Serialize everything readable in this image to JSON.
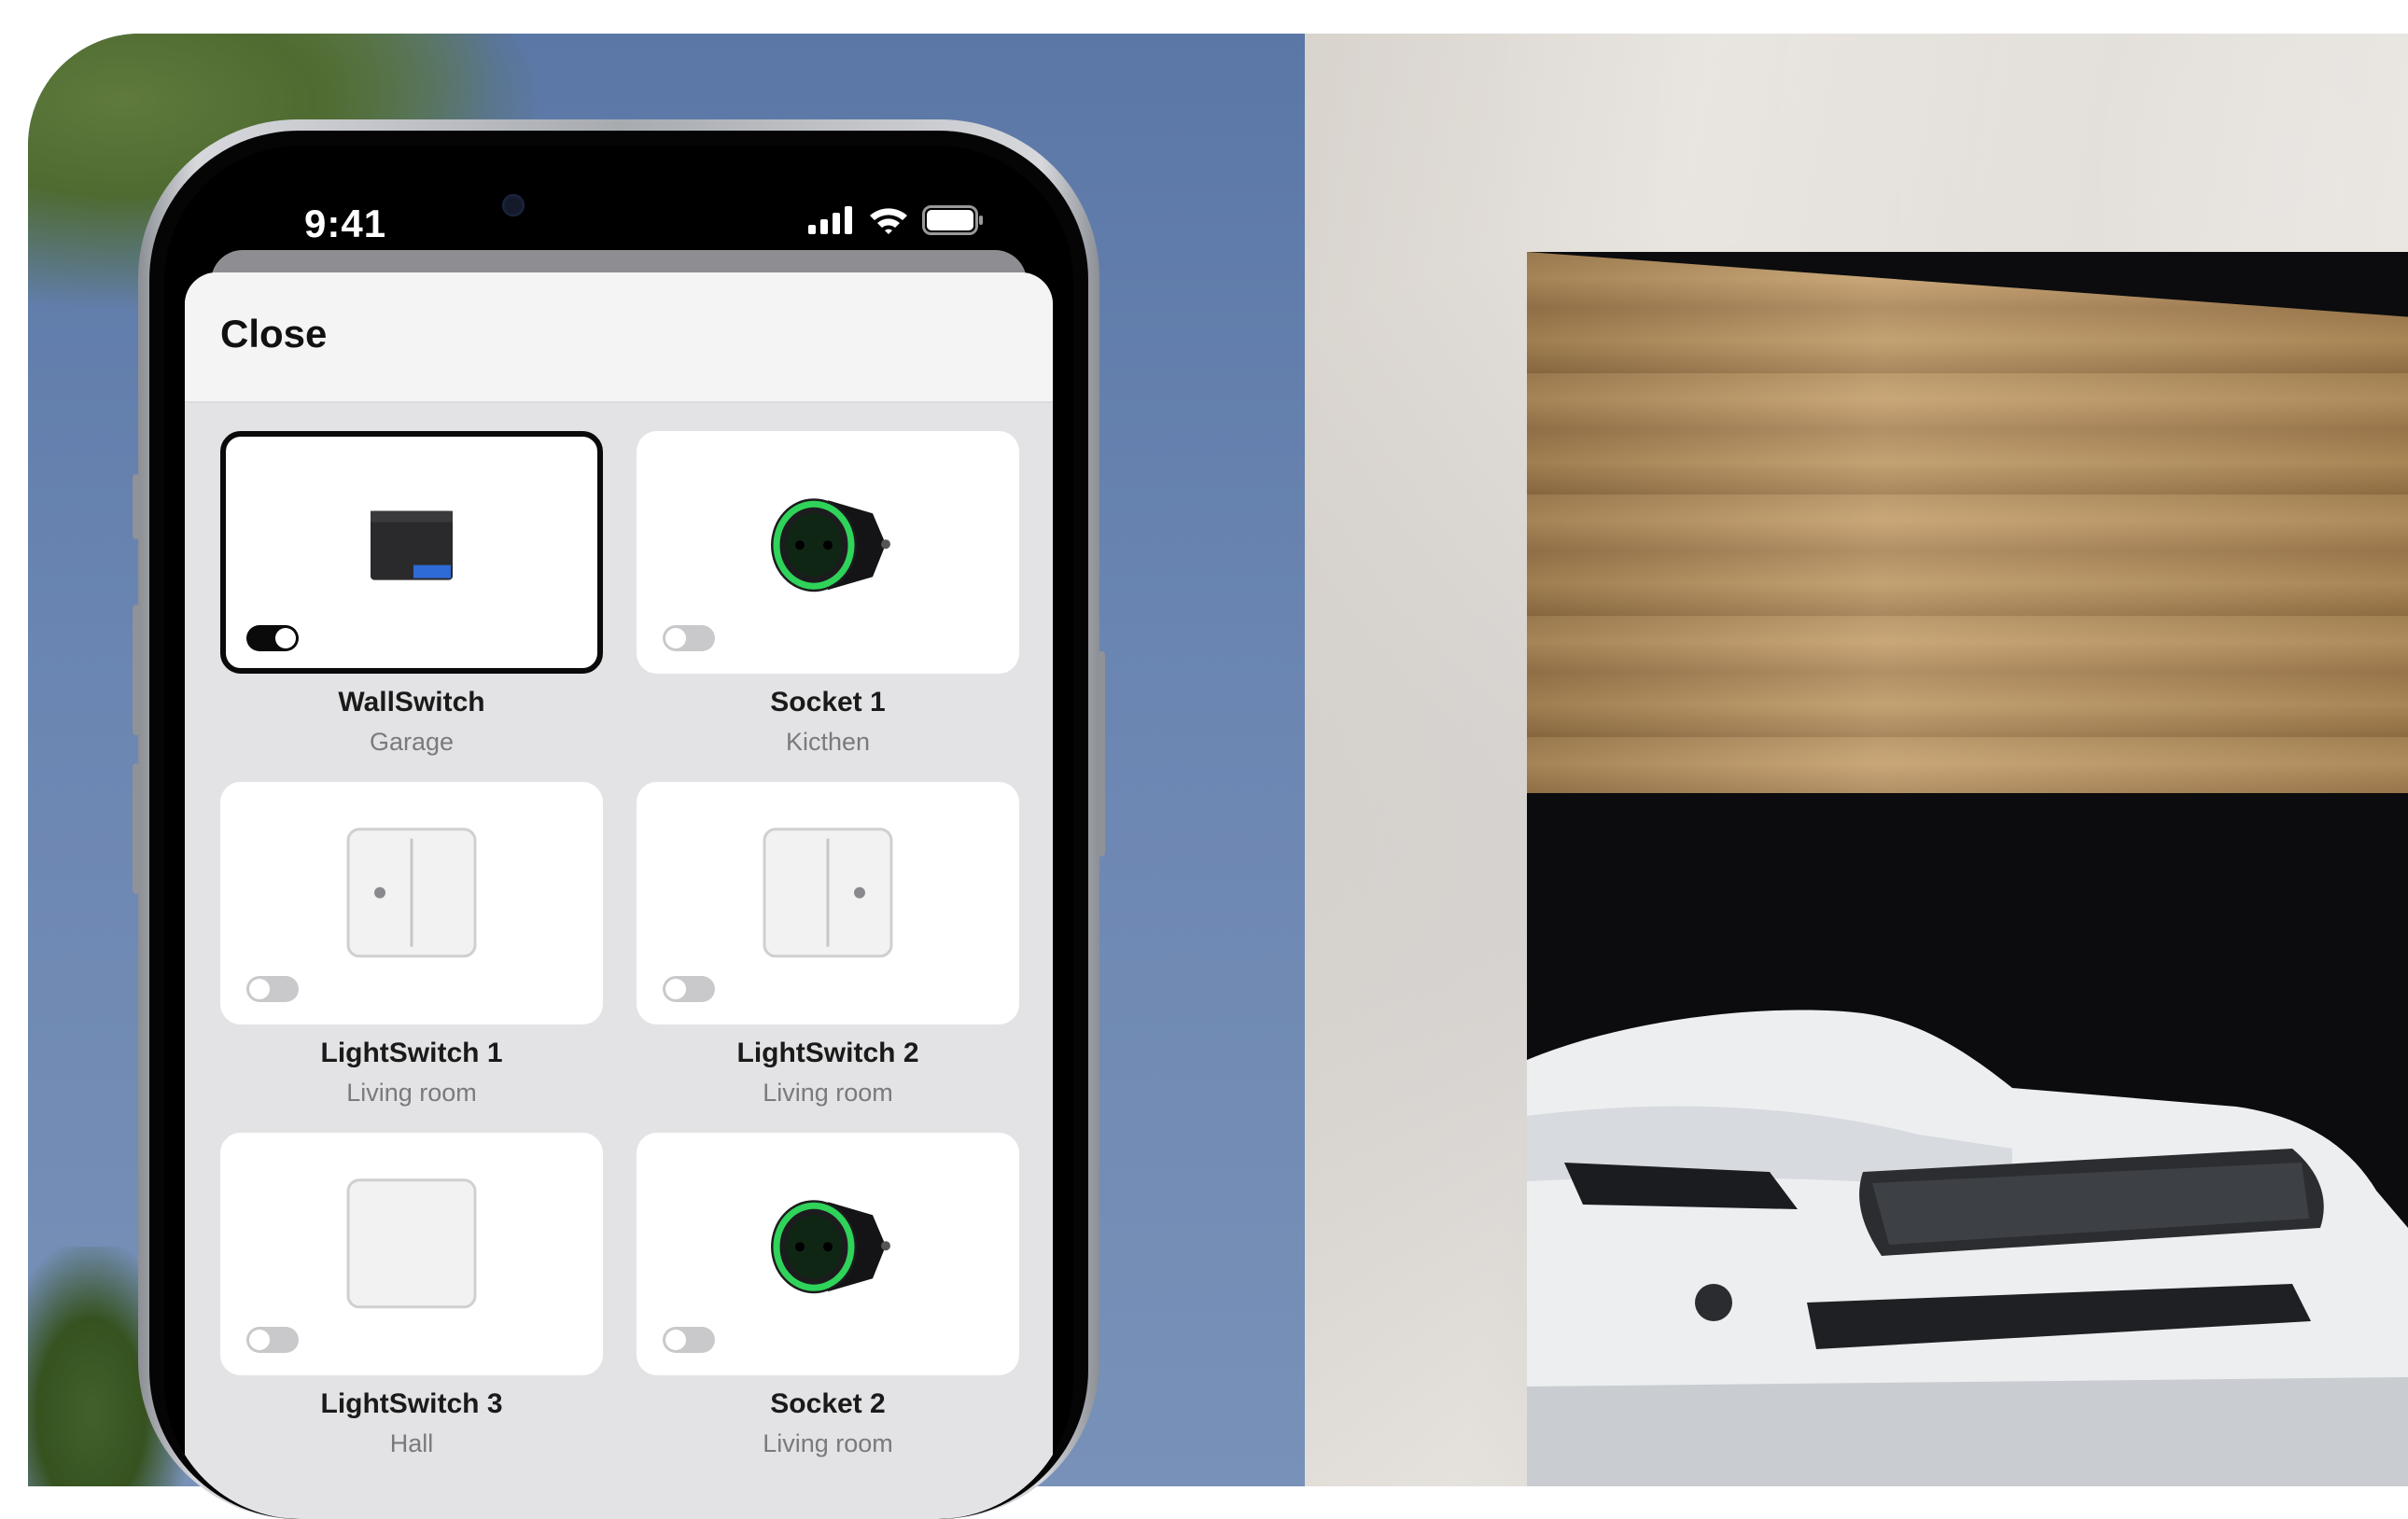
{
  "status_bar": {
    "time": "9:41"
  },
  "sheet": {
    "close_label": "Close"
  },
  "devices": [
    {
      "name": "WallSwitch",
      "room": "Garage",
      "icon": "wallswitch-icon",
      "toggle_on": true,
      "selected": true
    },
    {
      "name": "Socket 1",
      "room": "Kicthen",
      "icon": "socket-icon",
      "toggle_on": false,
      "selected": false
    },
    {
      "name": "LightSwitch 1",
      "room": "Living room",
      "icon": "lightswitch-two-gang-icon",
      "toggle_on": false,
      "selected": false
    },
    {
      "name": "LightSwitch 2",
      "room": "Living room",
      "icon": "lightswitch-two-gang-icon",
      "toggle_on": false,
      "selected": false
    },
    {
      "name": "LightSwitch 3",
      "room": "Hall",
      "icon": "lightswitch-one-gang-icon",
      "toggle_on": false,
      "selected": false
    },
    {
      "name": "Socket 2",
      "room": "Living room",
      "icon": "socket-icon",
      "toggle_on": false,
      "selected": false
    }
  ],
  "colors": {
    "accent": "#0a0a0a",
    "socket_ring": "#2fd35a",
    "toggle_off": "#c9c9cc"
  }
}
